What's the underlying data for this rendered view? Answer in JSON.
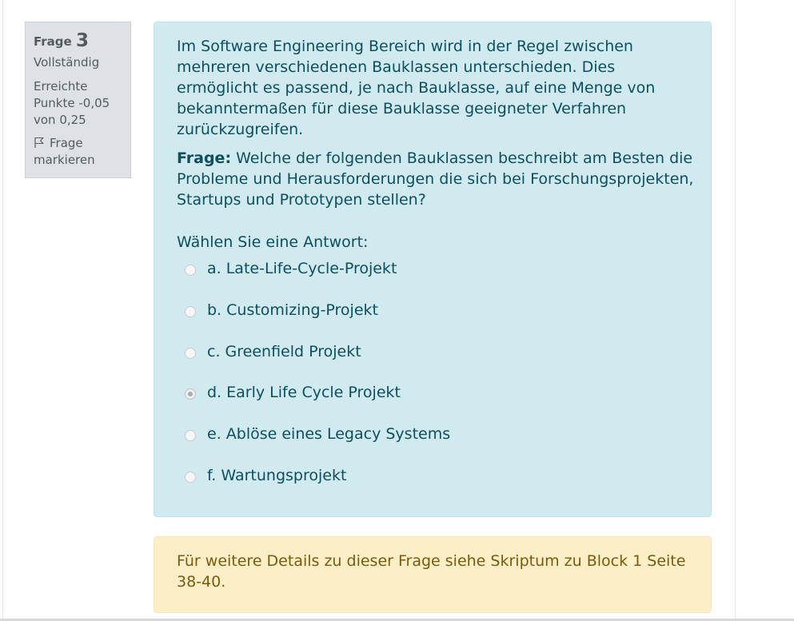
{
  "info": {
    "question_label": "Frage",
    "question_number": "3",
    "state": "Vollständig",
    "grade": "Erreichte Punkte -0,05 von 0,25",
    "flag_label": "Frage markieren"
  },
  "question": {
    "intro_text": "Im Software Engineering Bereich wird in der Regel zwischen mehreren verschiedenen Bauklassen unterschieden. Dies ermöglicht es passend, je nach Bauklasse, auf eine Menge von bekanntermaßen für diese Bauklasse geeigneter Verfahren zurückzugreifen.",
    "question_prefix": "Frage:",
    "question_text": "Welche der folgenden Bauklassen beschreibt am Besten die Probleme und Herausforderungen die sich bei Forschungsprojekten, Startups und Prototypen stellen?",
    "prompt": "Wählen Sie eine Antwort:",
    "answers": [
      {
        "label": "a. Late-Life-Cycle-Projekt",
        "selected": false
      },
      {
        "label": "b. Customizing-Projekt",
        "selected": false
      },
      {
        "label": "c. Greenfield Projekt",
        "selected": false
      },
      {
        "label": "d. Early Life Cycle Projekt",
        "selected": true
      },
      {
        "label": "e. Ablöse eines Legacy Systems",
        "selected": false
      },
      {
        "label": "f. Wartungsprojekt",
        "selected": false
      }
    ]
  },
  "feedback": {
    "text": "Für weitere Details zu dieser Frage siehe Skriptum zu Block 1 Seite 38-40."
  },
  "colors": {
    "info_background": "#dee2e6",
    "content_background": "#d0eaf0",
    "content_text": "#0c4f5e",
    "feedback_background": "#fcefc7",
    "feedback_text": "#7a5a0c"
  }
}
